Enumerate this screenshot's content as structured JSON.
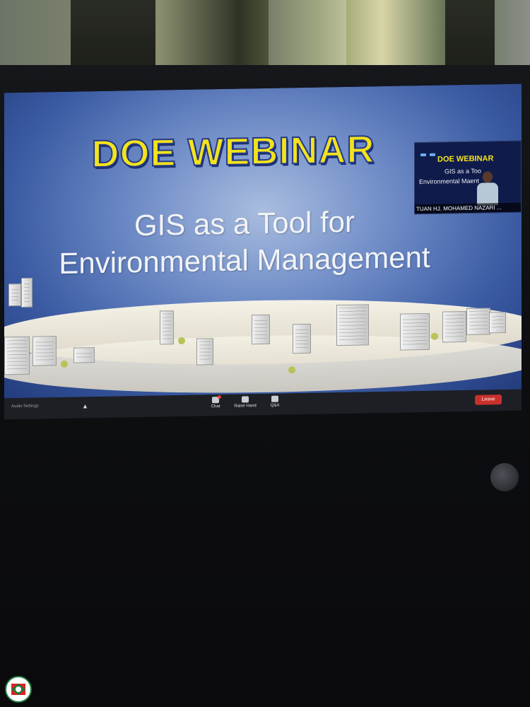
{
  "slide": {
    "title": "DOE WEBINAR",
    "subtitle_line1": "GIS as a Tool for",
    "subtitle_line2": "Environmental Management"
  },
  "video": {
    "title": "DOE WEBINAR",
    "line1": "GIS as a Too",
    "line2": "Environmental Ma",
    "line2_tail": "ent",
    "participant_name": "TUAN HJ. MOHAMED NAZARI ..."
  },
  "toolbar": {
    "audio_settings_label": "Audio Settings",
    "chat_label": "Chat",
    "raise_hand_label": "Raise Hand",
    "qa_label": "Q&A",
    "leave_label": "Leave"
  },
  "colors": {
    "title_yellow": "#f3e21d",
    "slide_blue": "#3a5aa2",
    "leave_red": "#c9302c"
  }
}
